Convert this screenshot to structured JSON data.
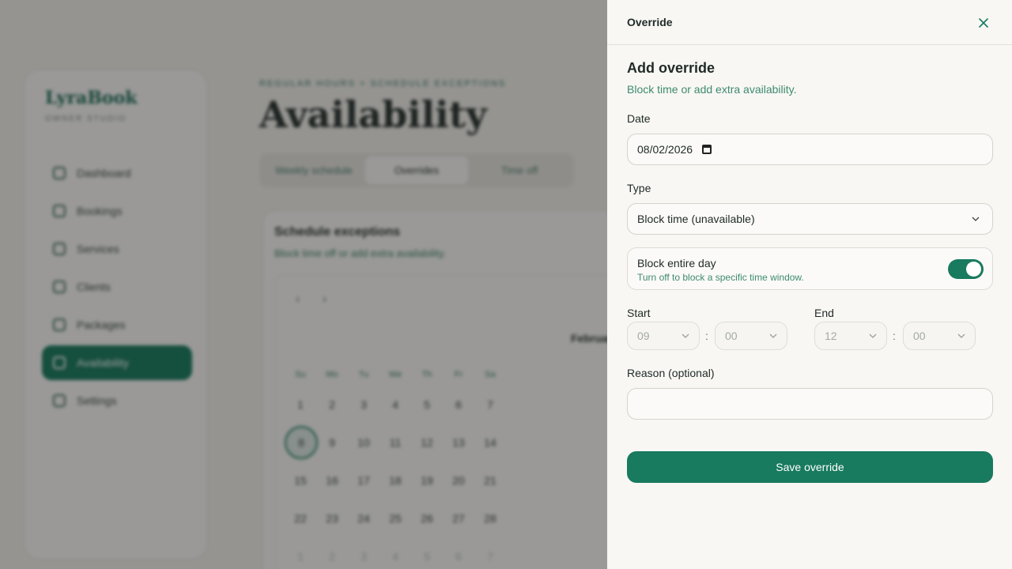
{
  "background": {
    "brand": "LyraBook",
    "brand_sub": "OWNER STUDIO",
    "nav": [
      {
        "label": "Dashboard",
        "icon": "chart-icon"
      },
      {
        "label": "Bookings",
        "icon": "calendar-icon"
      },
      {
        "label": "Services",
        "icon": "box-icon"
      },
      {
        "label": "Clients",
        "icon": "users-icon"
      },
      {
        "label": "Packages",
        "icon": "package-icon"
      },
      {
        "label": "Availability",
        "icon": "clock-icon",
        "active": true
      },
      {
        "label": "Settings",
        "icon": "gear-icon"
      }
    ],
    "breadcrumb": "REGULAR HOURS + SCHEDULE EXCEPTIONS",
    "page_title": "Availability",
    "tabs": [
      "Weekly schedule",
      "Overrides",
      "Time off"
    ],
    "active_tab": "Overrides",
    "card_title": "Schedule exceptions",
    "card_sub": "Block time off or add extra availability.",
    "calendar": {
      "prev": "‹",
      "next": "›",
      "month": "February",
      "weekdays": [
        "Su",
        "Mo",
        "Tu",
        "We",
        "Th",
        "Fr",
        "Sa"
      ],
      "weeks": [
        [
          "1",
          "2",
          "3",
          "4",
          "5",
          "6",
          "7"
        ],
        [
          "8",
          "9",
          "10",
          "11",
          "12",
          "13",
          "14"
        ],
        [
          "15",
          "16",
          "17",
          "18",
          "19",
          "20",
          "21"
        ],
        [
          "22",
          "23",
          "24",
          "25",
          "26",
          "27",
          "28"
        ],
        [
          "1",
          "2",
          "3",
          "4",
          "5",
          "6",
          "7"
        ]
      ],
      "today": "8"
    }
  },
  "drawer": {
    "title": "Override",
    "close_icon": "close-icon",
    "heading": "Add override",
    "subheading": "Block time or add extra availability.",
    "date": {
      "label": "Date",
      "value": "08/02/2026"
    },
    "type": {
      "label": "Type",
      "value": "Block time (unavailable)"
    },
    "block_day": {
      "title": "Block entire day",
      "desc": "Turn off to block a specific time window.",
      "on": true
    },
    "start": {
      "label": "Start",
      "hour": "09",
      "minute": "00"
    },
    "end": {
      "label": "End",
      "hour": "12",
      "minute": "00"
    },
    "time_separator": ":",
    "reason": {
      "label": "Reason (optional)",
      "value": "",
      "placeholder": ""
    },
    "save_label": "Save override"
  },
  "colors": {
    "accent": "#187a5e",
    "subtext": "#3e8a6f"
  }
}
